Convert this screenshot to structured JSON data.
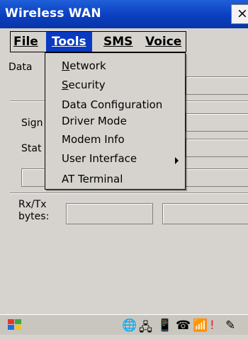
{
  "window": {
    "title": "Wireless WAN",
    "close_label": "×"
  },
  "menubar": {
    "file": "File",
    "tools": "Tools",
    "sms": "SMS",
    "voice": "Voice"
  },
  "content": {
    "data_label": "Data",
    "signal_label": "Sign",
    "status_label": "Stat",
    "rxtx_line1": "Rx/Tx",
    "rxtx_line2": "bytes:"
  },
  "tools_menu": {
    "items": [
      {
        "label": "Network",
        "underline": "N",
        "rest": "etwork"
      },
      {
        "label": "Security",
        "underline": "S",
        "rest": "ecurity"
      },
      {
        "label": "Data Configuration"
      },
      {
        "label": "Driver Mode"
      },
      {
        "label": "Modem Info"
      },
      {
        "label": "User Interface",
        "has_submenu": true
      },
      {
        "label": "AT Terminal"
      }
    ]
  },
  "taskbar": {
    "icons": [
      "windows-start-icon",
      "globe-icon",
      "network-icon",
      "phone-icon",
      "modem-icon",
      "signal-icon",
      "warning-icon",
      "stylus-icon"
    ]
  },
  "colors": {
    "titlebar": "#0b3fc0",
    "menu_highlight": "#0a3ac0",
    "background": "#d6d3ce"
  }
}
